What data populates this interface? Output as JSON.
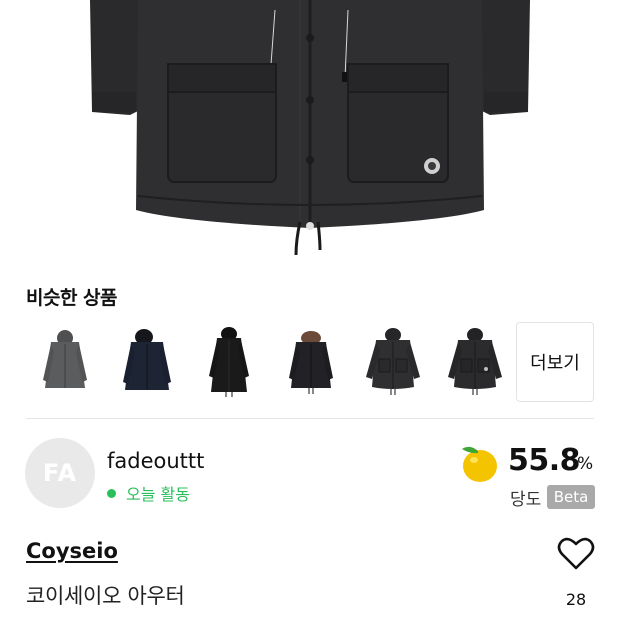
{
  "similar": {
    "title": "비슷한 상품",
    "items": [
      {
        "name": "jacket-gray",
        "color": "#5a5c5e"
      },
      {
        "name": "parka-navy",
        "color": "#1d2433"
      },
      {
        "name": "long-parka-black",
        "color": "#1a1a1a"
      },
      {
        "name": "parka-fur-black",
        "color": "#222226"
      },
      {
        "name": "fishtail-black",
        "color": "#2f2f31"
      },
      {
        "name": "fishtail-dark",
        "color": "#2b2b2d"
      }
    ],
    "more_label": "더보기"
  },
  "seller": {
    "avatar_text": "FA",
    "name": "fadeouttt",
    "activity": "오늘 활동"
  },
  "sweetness": {
    "value": "55.8",
    "unit": "%",
    "label": "당도",
    "badge": "Beta"
  },
  "product": {
    "brand": "Coyseio",
    "name": "코이세이오 아우터",
    "likes": "28"
  },
  "colors": {
    "accent_green": "#2bbf5b",
    "fruit_yellow": "#f5c400",
    "jacket": "#2e2e30"
  }
}
